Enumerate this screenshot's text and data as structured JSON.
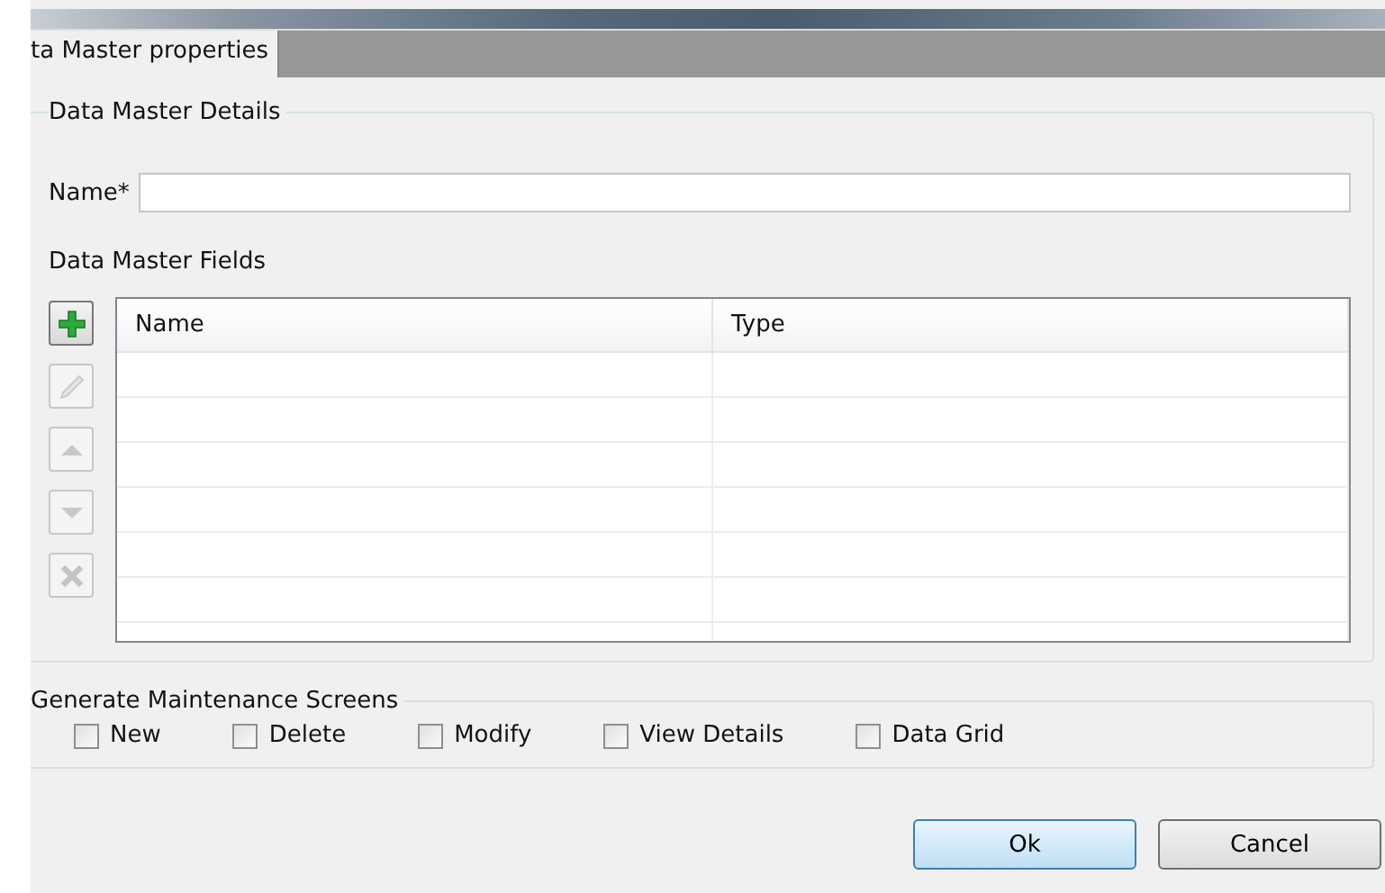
{
  "tab": {
    "label": "ta Master properties",
    "selected": true
  },
  "details": {
    "title": "Data Master Details",
    "name_label": "Name*",
    "fields_label": "Data Master Fields"
  },
  "tools": [
    {
      "kind": "add",
      "disabled": false
    },
    {
      "kind": "edit",
      "disabled": true
    },
    {
      "kind": "up",
      "disabled": true
    },
    {
      "kind": "down",
      "disabled": true
    },
    {
      "kind": "delete",
      "disabled": true
    }
  ],
  "table": {
    "columns": [
      "Name",
      "Type"
    ]
  },
  "screens": {
    "title": "Generate Maintenance Screens",
    "options": [
      {
        "label": "New",
        "checked": false
      },
      {
        "label": "Delete",
        "checked": false
      },
      {
        "label": "Modify",
        "checked": false
      },
      {
        "label": "View Details",
        "checked": false
      },
      {
        "label": "Data Grid",
        "checked": false
      }
    ]
  },
  "buttons": [
    {
      "label": "Ok",
      "default": true
    },
    {
      "label": "Cancel",
      "default": false
    }
  ]
}
